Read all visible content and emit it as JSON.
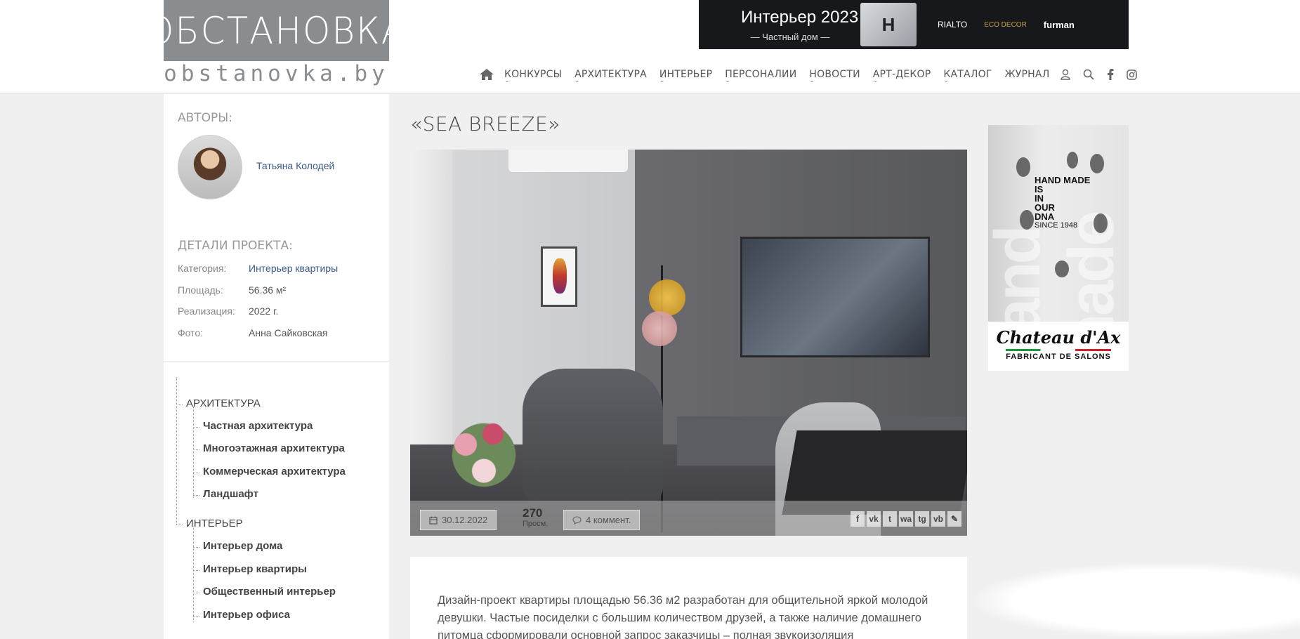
{
  "logo": {
    "name": "ОБСТАНОВКА",
    "url": "obstanovka.by"
  },
  "banner": {
    "title": "Интерьер 2023",
    "subtitle": "— Частный дом —",
    "cube_mark": "H",
    "brands": [
      "RIALTO",
      "ECO DECOR",
      "furman"
    ]
  },
  "nav": {
    "items": [
      "КОНКУРСЫ",
      "АРХИТЕКТУРА",
      "ИНТЕРЬЕР",
      "ПЕРСОНАЛИИ",
      "НОВОСТИ",
      "АРТ-ДЕКОР",
      "КАТАЛОГ",
      "ЖУРНАЛ"
    ],
    "icons": [
      "home-icon",
      "user-icon",
      "search-icon",
      "facebook-icon",
      "instagram-icon"
    ]
  },
  "sidebar": {
    "authors_title": "АВТОРЫ:",
    "author_name": "Татьяна Колодей",
    "details_title": "ДЕТАЛИ ПРОЕКТА:",
    "details": [
      {
        "key": "Категория:",
        "value": "Интерьер квартиры"
      },
      {
        "key": "Площадь:",
        "value": "56.36 м²"
      },
      {
        "key": "Реализация:",
        "value": "2022 г."
      },
      {
        "key": "Фото:",
        "value": "Анна Сайковская"
      }
    ],
    "tree": [
      {
        "label": "АРХИТЕКТУРА",
        "children": [
          "Частная архитектура",
          "Многоэтажная архитектура",
          "Коммерческая архитектура",
          "Ландшафт"
        ]
      },
      {
        "label": "ИНТЕРЬЕР",
        "children": [
          "Интерьер дома",
          "Интерьер квартиры",
          "Общественный интерьер",
          "Интерьер офиса"
        ]
      }
    ]
  },
  "main": {
    "title": "«SEA BREEZE»",
    "date": "30.12.2022",
    "views_count": "270",
    "views_label": "Просм.",
    "comments": "4 коммент.",
    "share": [
      "f",
      "vk",
      "t",
      "wa",
      "tg",
      "vb",
      "✎"
    ],
    "text": "Дизайн-проект квартиры площадью 56.36 м2 разработан для общительной яркой молодой девушки. Частые посиделки с большим количеством друзей, а также наличие домашнего питомца сформировали основной запрос заказчицы – полная звукоизоляция"
  },
  "ad": {
    "lines": [
      "HAND MADE",
      "IS",
      "IN",
      "OUR",
      "DNA"
    ],
    "since": "SINCE 1948",
    "brand": "Chateau d'Ax",
    "tagline": "FABRICANT DE SALONS",
    "bg_word": "hand made"
  }
}
